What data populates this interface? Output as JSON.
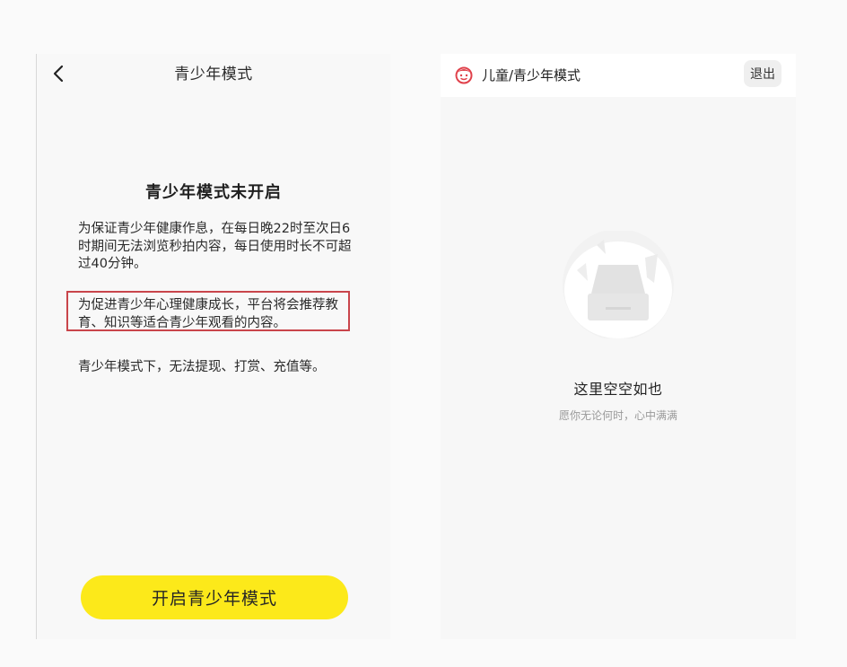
{
  "left_screen": {
    "header": {
      "title": "青少年模式",
      "back_icon": "chevron-left-icon"
    },
    "status_heading": "青少年模式未开启",
    "paragraphs": [
      "为保证青少年健康作息，在每日晚22时至次日6时期间无法浏览秒拍内容，每日使用时长不可超过40分钟。",
      "为促进青少年心理健康成长，平台将会推荐教育、知识等适合青少年观看的内容。",
      "青少年模式下，无法提现、打赏、充值等。"
    ],
    "highlight_color": "#c9454b",
    "primary_button_label": "开启青少年模式",
    "primary_button_color": "#fce91a"
  },
  "right_screen": {
    "header": {
      "icon": "kid-face-icon",
      "title": "儿童/青少年模式",
      "exit_label": "退出"
    },
    "empty_state": {
      "illustration": "empty-box-icon",
      "title": "这里空空如也",
      "subtitle": "愿你无论何时，心中满满"
    }
  }
}
